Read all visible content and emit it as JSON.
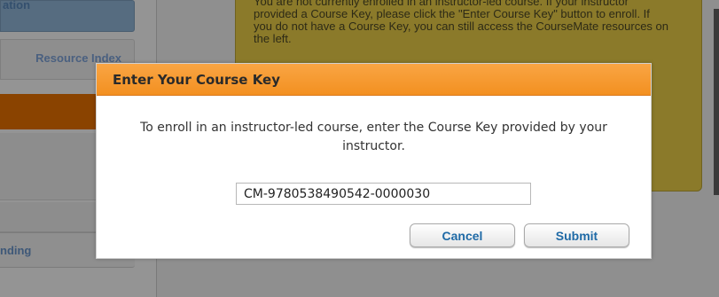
{
  "background": {
    "sidebar": {
      "top_label": "ation",
      "resource_label": "Resource Index",
      "pending_label": "nding"
    },
    "info_text": "You are not currently enrolled in an instructor-led course. If your instructor provided a Course Key, please click the \"Enter Course Key\" button to enroll. If you do not have a Course Key, you can still access the CourseMate resources on the left."
  },
  "modal": {
    "title": "Enter Your Course Key",
    "message": "To enroll in an instructor-led course, enter the Course Key provided by your instructor.",
    "course_key_value": "CM-9780538490542-0000030",
    "cancel_label": "Cancel",
    "submit_label": "Submit"
  },
  "colors": {
    "header_orange": "#f39020",
    "button_text_blue": "#1f6aa6",
    "overlay_gray": "#8f8f8f"
  }
}
